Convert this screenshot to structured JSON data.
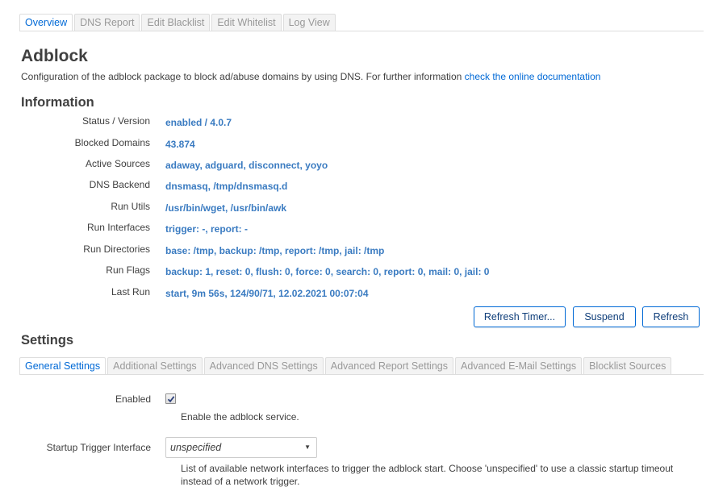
{
  "top_tabs": [
    {
      "label": "Overview",
      "active": true
    },
    {
      "label": "DNS Report",
      "active": false
    },
    {
      "label": "Edit Blacklist",
      "active": false
    },
    {
      "label": "Edit Whitelist",
      "active": false
    },
    {
      "label": "Log View",
      "active": false
    }
  ],
  "page": {
    "title": "Adblock",
    "description": "Configuration of the adblock package to block ad/abuse domains by using DNS. For further information ",
    "doc_link": "check the online documentation"
  },
  "information": {
    "heading": "Information",
    "rows": [
      {
        "label": "Status / Version",
        "value": "enabled / 4.0.7"
      },
      {
        "label": "Blocked Domains",
        "value": "43.874"
      },
      {
        "label": "Active Sources",
        "value": "adaway, adguard, disconnect, yoyo"
      },
      {
        "label": "DNS Backend",
        "value": "dnsmasq, /tmp/dnsmasq.d"
      },
      {
        "label": "Run Utils",
        "value": "/usr/bin/wget, /usr/bin/awk"
      },
      {
        "label": "Run Interfaces",
        "value": "trigger: -, report: -"
      },
      {
        "label": "Run Directories",
        "value": "base: /tmp, backup: /tmp, report: /tmp, jail: /tmp"
      },
      {
        "label": "Run Flags",
        "value": "backup: 1, reset: 0, flush: 0, force: 0, search: 0, report: 0, mail: 0, jail: 0"
      },
      {
        "label": "Last Run",
        "value": "start, 9m 56s, 124/90/71, 12.02.2021 00:07:04"
      }
    ]
  },
  "actions": {
    "refresh_timer": "Refresh Timer...",
    "suspend": "Suspend",
    "refresh": "Refresh"
  },
  "settings": {
    "heading": "Settings",
    "tabs": [
      {
        "label": "General Settings",
        "active": true
      },
      {
        "label": "Additional Settings",
        "active": false
      },
      {
        "label": "Advanced DNS Settings",
        "active": false
      },
      {
        "label": "Advanced Report Settings",
        "active": false
      },
      {
        "label": "Advanced E-Mail Settings",
        "active": false
      },
      {
        "label": "Blocklist Sources",
        "active": false
      }
    ],
    "enabled": {
      "label": "Enabled",
      "checked": true,
      "help": "Enable the adblock service."
    },
    "trigger": {
      "label": "Startup Trigger Interface",
      "value": "unspecified",
      "help_line1": "List of available network interfaces to trigger the adblock start. Choose 'unspecified' to use a classic startup timeout",
      "help_line2": "instead of a network trigger."
    }
  },
  "colors": {
    "accent": "#0069d6",
    "value_text": "#3a7bc1",
    "body_text": "#404040",
    "inactive_tab_text": "#999999"
  }
}
